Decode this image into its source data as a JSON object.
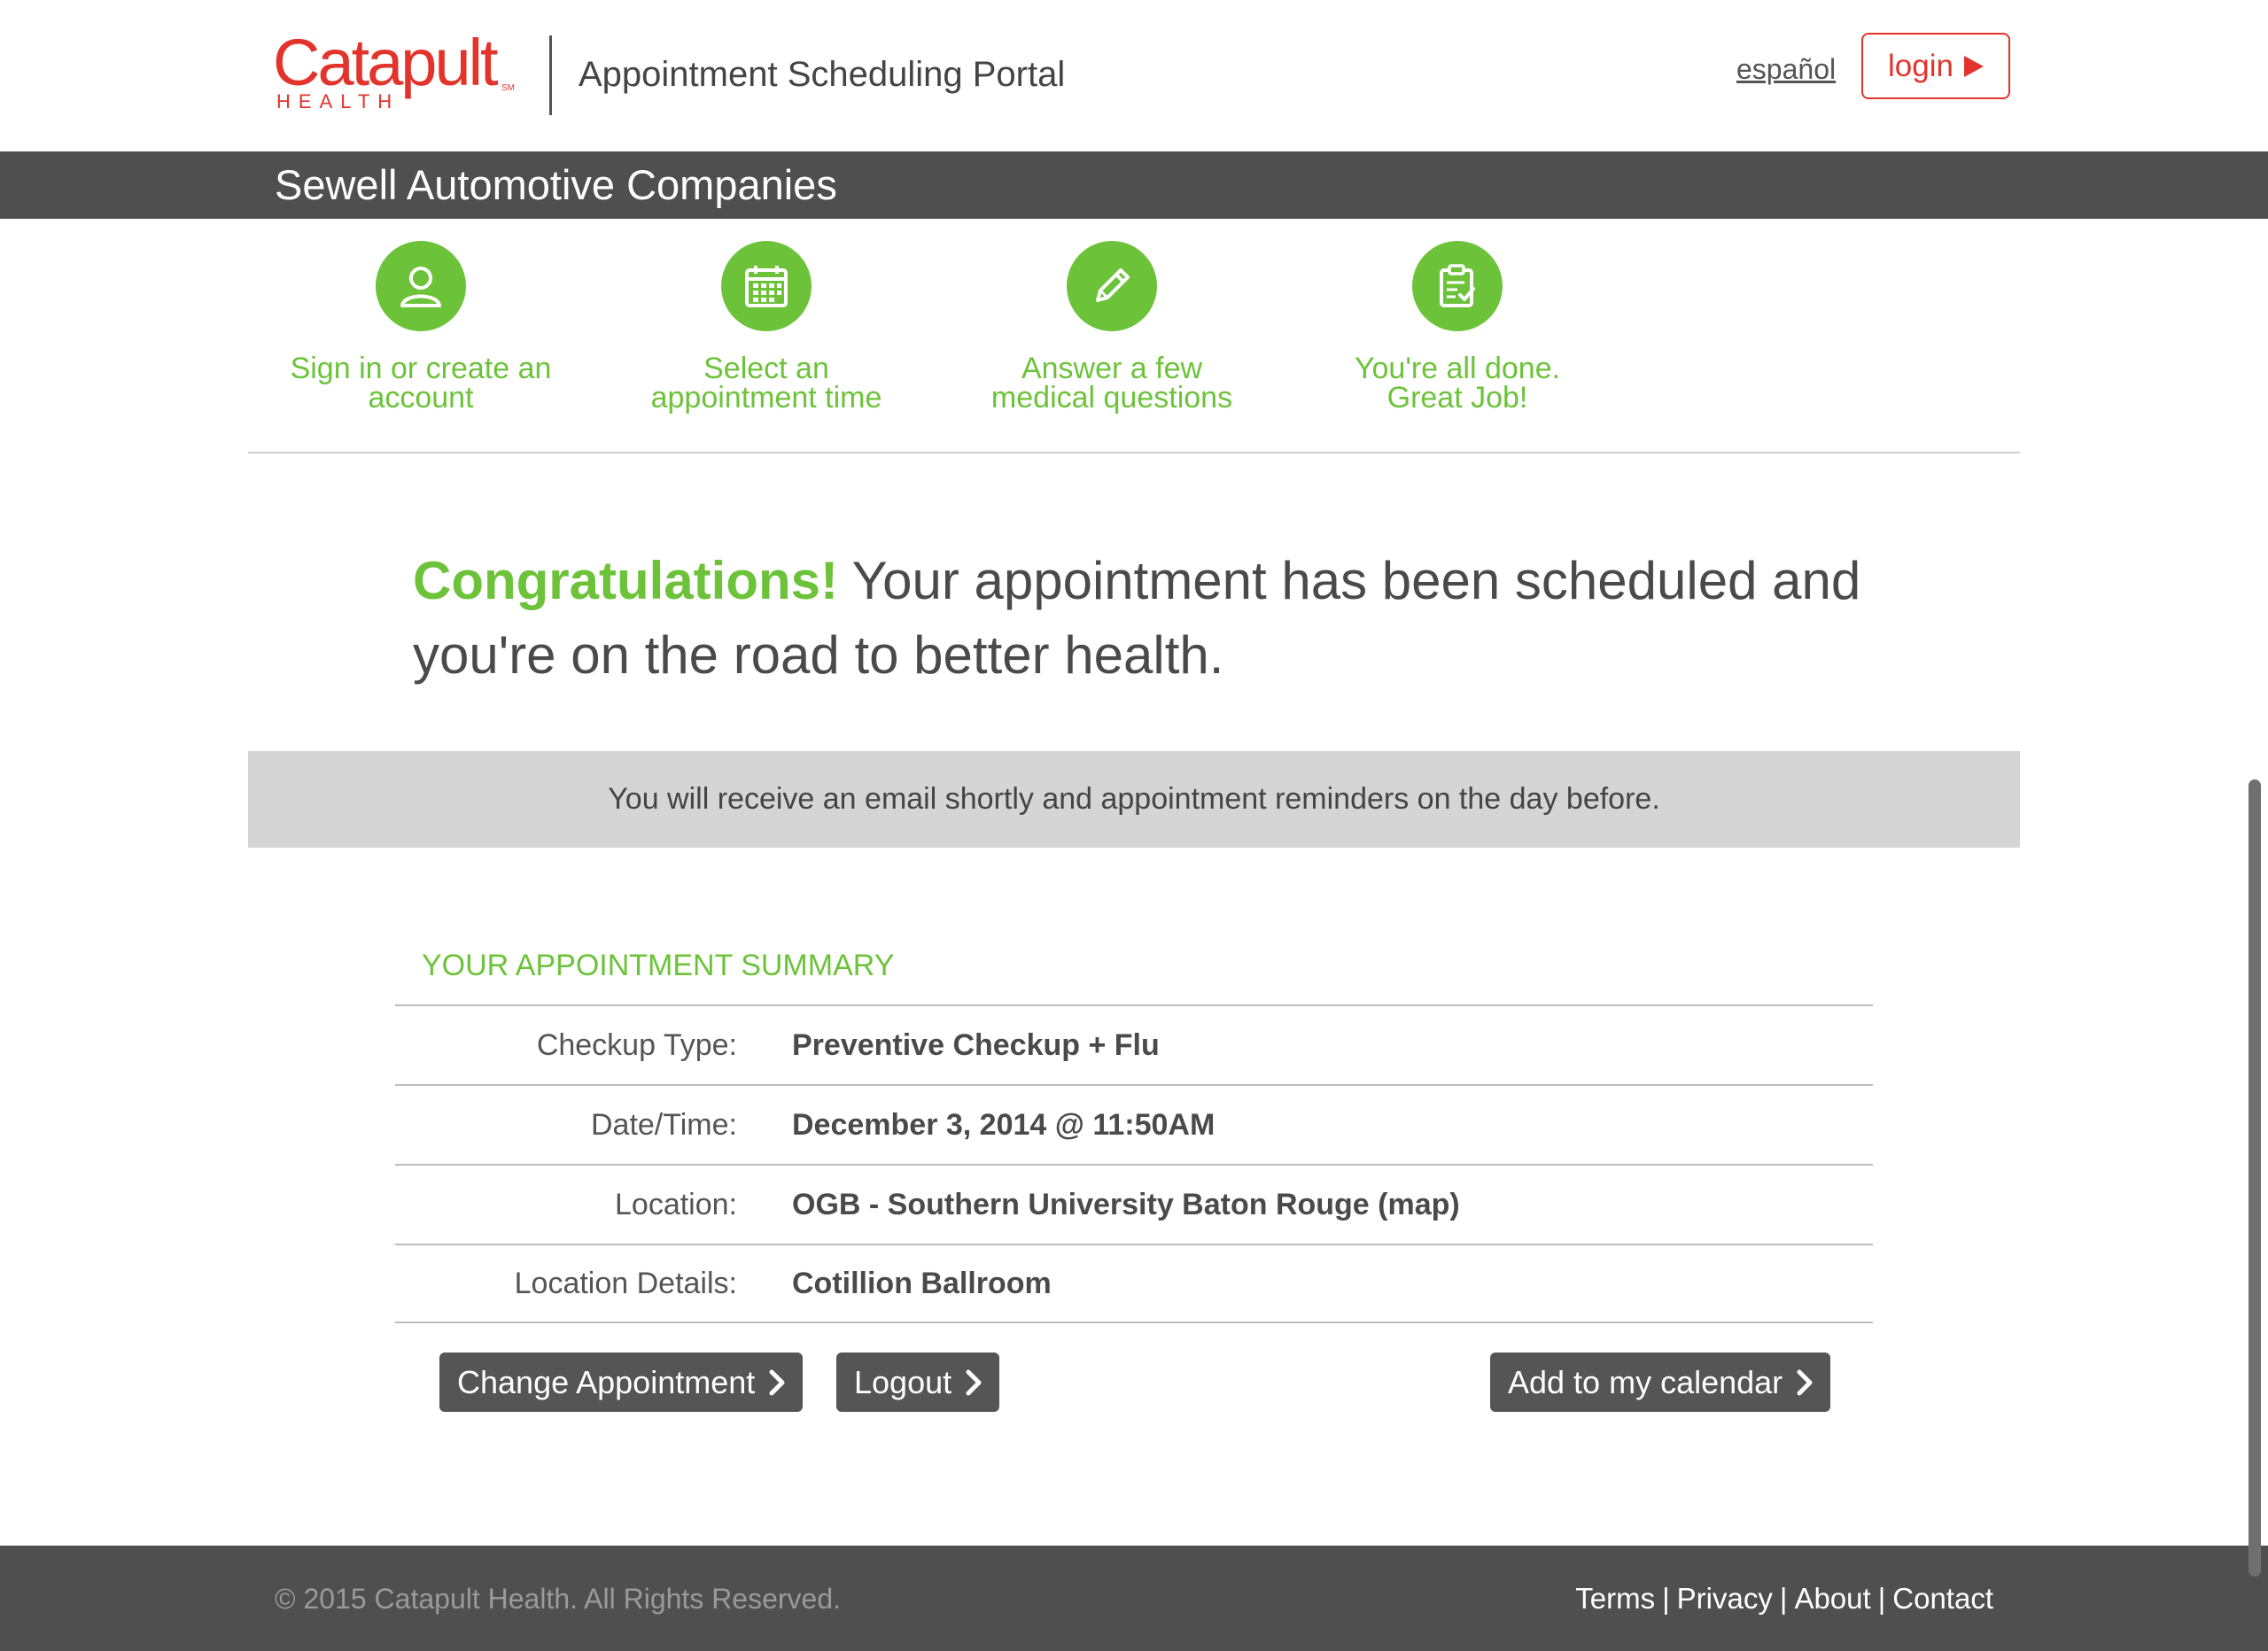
{
  "header": {
    "logo_text": "Catapult",
    "logo_sub": "HEALTH",
    "logo_mark": "SM",
    "portal_title": "Appointment Scheduling Portal",
    "language_link": "español",
    "login_label": "login"
  },
  "company": {
    "name": "Sewell Automotive Companies"
  },
  "steps": [
    {
      "icon": "person-icon",
      "label_line1": "Sign in or create an",
      "label_line2": "account"
    },
    {
      "icon": "calendar-icon",
      "label_line1": "Select an",
      "label_line2": "appointment time"
    },
    {
      "icon": "pencil-icon",
      "label_line1": "Answer a few",
      "label_line2": "medical questions"
    },
    {
      "icon": "clipboard-check-icon",
      "label_line1": "You're all done.",
      "label_line2": "Great Job!"
    }
  ],
  "congrats": {
    "highlight": "Congratulations!",
    "message": " Your appointment has been scheduled and you're on the road to better health."
  },
  "notice": "You will receive an email shortly and appointment reminders on the day before.",
  "summary": {
    "title": "YOUR APPOINTMENT SUMMARY",
    "rows": [
      {
        "label": "Checkup Type:",
        "value": "Preventive Checkup + Flu"
      },
      {
        "label": "Date/Time:",
        "value": "December 3, 2014 @ 11:50AM"
      },
      {
        "label": "Location:",
        "value": "OGB - Southern University Baton Rouge (map)"
      },
      {
        "label": "Location Details:",
        "value": "Cotillion Ballroom"
      }
    ]
  },
  "buttons": {
    "change": "Change Appointment",
    "logout": "Logout",
    "calendar": "Add to my calendar"
  },
  "footer": {
    "copyright": "© 2015 Catapult Health. All Rights Reserved.",
    "links": [
      "Terms",
      "Privacy",
      "About",
      "Contact"
    ],
    "separator": "|"
  },
  "colors": {
    "brand_red": "#e3342c",
    "accent_green": "#6cc33a",
    "dark_bar": "#4f4f4f",
    "button_gray": "#555555"
  }
}
